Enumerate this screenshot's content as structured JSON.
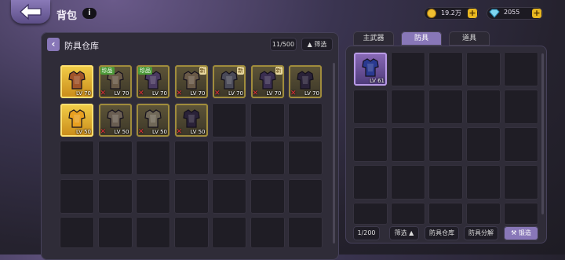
{
  "header": {
    "title": "背包",
    "info": "i"
  },
  "currency": {
    "gold": "19.2万",
    "gem": "2055",
    "plus": "+"
  },
  "warehouse": {
    "back": "‹",
    "title": "防具仓库",
    "capacity": "11/500",
    "filter": "▲ 筛选",
    "items": [
      {
        "lv": "LV 70",
        "style": "gold",
        "tag": "",
        "new": false,
        "x": false,
        "color": "#a0542a"
      },
      {
        "lv": "LV 70",
        "style": "",
        "tag": "珍品",
        "new": false,
        "x": true,
        "color": "#6a5a48"
      },
      {
        "lv": "LV 70",
        "style": "",
        "tag": "珍品",
        "new": false,
        "x": true,
        "color": "#4a3a60"
      },
      {
        "lv": "LV 70",
        "style": "",
        "tag": "",
        "new": true,
        "x": true,
        "color": "#6a5a48"
      },
      {
        "lv": "LV 70",
        "style": "",
        "tag": "",
        "new": true,
        "x": true,
        "color": "#4a4a58"
      },
      {
        "lv": "LV 70",
        "style": "",
        "tag": "",
        "new": true,
        "x": true,
        "color": "#3a2e50"
      },
      {
        "lv": "LV 70",
        "style": "",
        "tag": "",
        "new": false,
        "x": true,
        "color": "#2a2238"
      },
      {
        "lv": "LV 50",
        "style": "gold",
        "tag": "",
        "new": false,
        "x": false,
        "color": "#e8a020"
      },
      {
        "lv": "LV 50",
        "style": "",
        "tag": "",
        "new": false,
        "x": true,
        "color": "#6a5e52"
      },
      {
        "lv": "LV 50",
        "style": "",
        "tag": "",
        "new": false,
        "x": true,
        "color": "#706858"
      },
      {
        "lv": "LV 50",
        "style": "",
        "tag": "",
        "new": false,
        "x": true,
        "color": "#2a2238"
      }
    ]
  },
  "tabs": [
    "主武器",
    "防具",
    "道具"
  ],
  "active_tab": 1,
  "equipped": {
    "items": [
      {
        "lv": "LV 61",
        "style": "violet",
        "color": "#2a3a90"
      }
    ]
  },
  "bottom": {
    "capacity": "1/200",
    "filter": "筛选 ▲",
    "warehouse": "防具仓库",
    "decompose": "防具分解",
    "forge": "锻造"
  }
}
